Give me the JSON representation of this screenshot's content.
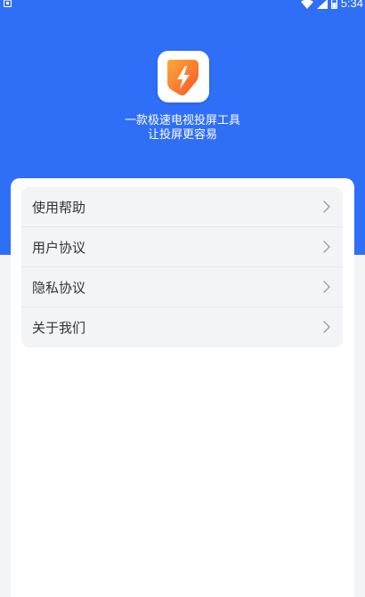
{
  "colors": {
    "header_blue": "#2f6ef6",
    "page_bg": "#f3f4f6",
    "logo_orange": "#f86a2a",
    "logo_orange_light": "#fdaa3a"
  },
  "status_bar": {
    "time": "5:34",
    "icons": [
      "notification-icon",
      "wifi-icon",
      "signal-icon",
      "battery-icon"
    ]
  },
  "header": {
    "logo": "lightning-bolt-icon",
    "tagline_line1": "一款极速电视投屏工具",
    "tagline_line2": "让投屏更容易"
  },
  "menu": {
    "items": [
      {
        "label": "使用帮助",
        "icon": "chevron-right-icon"
      },
      {
        "label": "用户协议",
        "icon": "chevron-right-icon"
      },
      {
        "label": "隐私协议",
        "icon": "chevron-right-icon"
      },
      {
        "label": "关于我们",
        "icon": "chevron-right-icon"
      }
    ]
  }
}
